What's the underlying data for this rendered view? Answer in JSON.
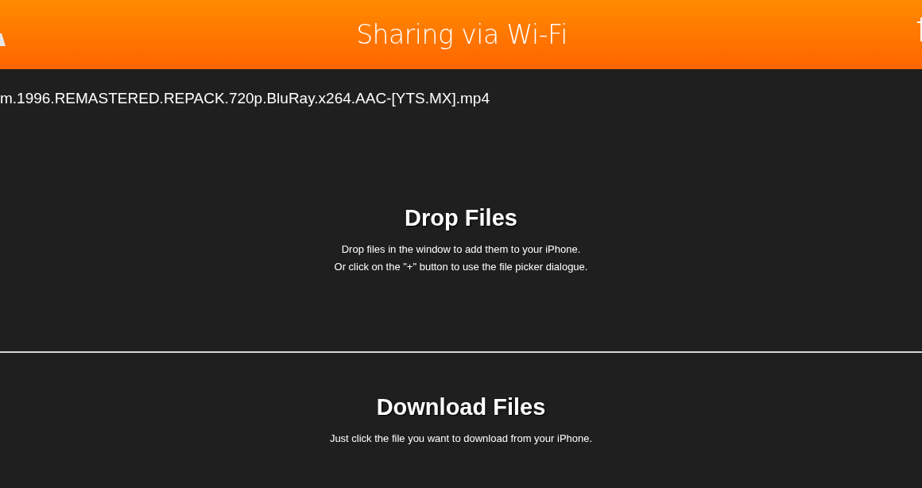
{
  "header": {
    "title": "Sharing via Wi-Fi"
  },
  "files": [
    {
      "name": "m.1996.REMASTERED.REPACK.720p.BluRay.x264.AAC-[YTS.MX].mp4"
    }
  ],
  "sections": [
    {
      "title": "Drop Files",
      "lines": [
        "Drop files in the window to add them to your iPhone.",
        "Or click on the \"+\" button to use the file picker dialogue."
      ]
    },
    {
      "title": "Download Files",
      "lines": [
        "Just click the file you want to download from your iPhone."
      ]
    }
  ]
}
